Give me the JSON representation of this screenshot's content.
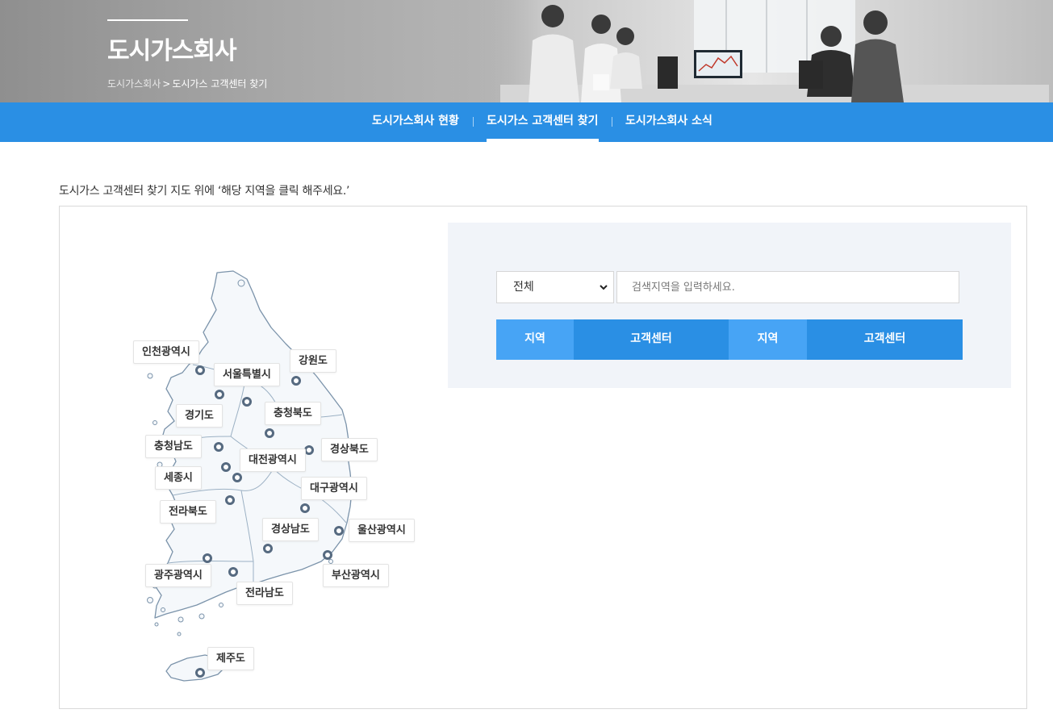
{
  "banner": {
    "title": "도시가스회사",
    "breadcrumb": {
      "home": "도시가스회사",
      "separator": ">",
      "current": "도시가스 고객센터 찾기"
    }
  },
  "subnav": {
    "tabs": [
      {
        "label": "도시가스회사 현황",
        "active": false
      },
      {
        "label": "도시가스 고객센터 찾기",
        "active": true
      },
      {
        "label": "도시가스회사 소식",
        "active": false
      }
    ]
  },
  "instruction": "도시가스 고객센터 찾기 지도 위에 ‘해당 지역을 클릭 해주세요.’",
  "map": {
    "regions": [
      {
        "key": "incheon",
        "label": "인천광역시"
      },
      {
        "key": "seoul",
        "label": "서울특별시"
      },
      {
        "key": "gangwon",
        "label": "강원도"
      },
      {
        "key": "gyeonggi",
        "label": "경기도"
      },
      {
        "key": "chungbuk",
        "label": "충청북도"
      },
      {
        "key": "chungnam",
        "label": "충청남도"
      },
      {
        "key": "gyeongbuk",
        "label": "경상북도"
      },
      {
        "key": "daejeon",
        "label": "대전광역시"
      },
      {
        "key": "sejong",
        "label": "세종시"
      },
      {
        "key": "daegu",
        "label": "대구광역시"
      },
      {
        "key": "jeonbuk",
        "label": "전라북도"
      },
      {
        "key": "gyeongnam",
        "label": "경상남도"
      },
      {
        "key": "ulsan",
        "label": "울산광역시"
      },
      {
        "key": "gwangju",
        "label": "광주광역시"
      },
      {
        "key": "busan",
        "label": "부산광역시"
      },
      {
        "key": "jeonnam",
        "label": "전라남도"
      },
      {
        "key": "jeju",
        "label": "제주도"
      }
    ]
  },
  "search": {
    "select_value": "전체",
    "input_placeholder": "검색지역을 입력하세요.",
    "columns": [
      "지역",
      "고객센터",
      "지역",
      "고객센터"
    ]
  },
  "colors": {
    "accent": "#2a8fe4",
    "accent_light": "#47a4f5",
    "marker": "#566a80",
    "search_bg": "#f1f4f9"
  }
}
